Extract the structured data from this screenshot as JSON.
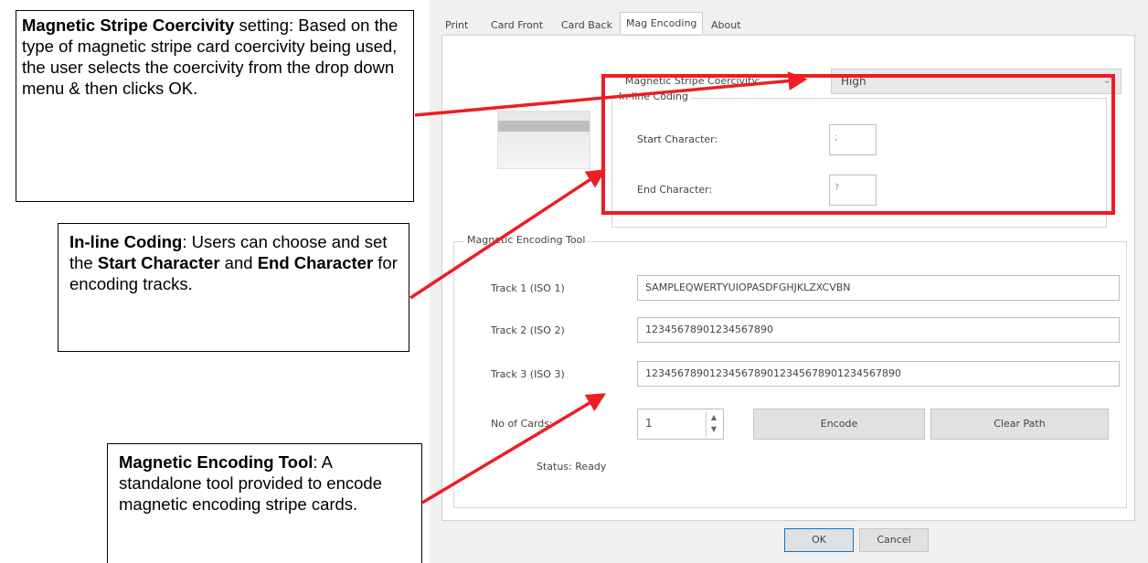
{
  "callouts": {
    "coercivity": {
      "title": "Magnetic Stripe Coercivity",
      "text": " setting: Based on the type of magnetic stripe card coercivity being used, the user selects the coercivity from the drop down menu & then clicks OK."
    },
    "inline": {
      "title": "In-line Coding",
      "text1": ": Users can choose and set the ",
      "bold1": "Start Character",
      "text2": " and ",
      "bold2": "End Character",
      "text3": " for encoding tracks."
    },
    "encoding": {
      "title": "Magnetic Encoding Tool",
      "text": ": A standalone tool provided to encode magnetic encoding stripe cards."
    }
  },
  "tabs": [
    "Print",
    "Card Front",
    "Card Back",
    "Mag Encoding",
    "About"
  ],
  "active_tab": "Mag Encoding",
  "coercivity": {
    "label": "Magnetic Stripe Coercivity:",
    "value": "High"
  },
  "inline": {
    "title": "In-line Coding",
    "start_label": "Start Character:",
    "start_value": ";",
    "end_label": "End Character:",
    "end_value": "?"
  },
  "encoding": {
    "title": "Magnetic Encoding Tool",
    "track1_label": "Track 1 (ISO 1)",
    "track1_value": "SAMPLEQWERTYUIOPASDFGHJKLZXCVBN",
    "track2_label": "Track 2 (ISO 2)",
    "track2_value": "12345678901234567890",
    "track3_label": "Track 3 (ISO 3)",
    "track3_value": "1234567890123456789012345678901234567890",
    "cards_label": "No of Cards:",
    "cards_value": "1",
    "encode_label": "Encode",
    "clear_label": "Clear Path",
    "status": "Status: Ready"
  },
  "buttons": {
    "ok": "OK",
    "cancel": "Cancel"
  },
  "colors": {
    "annotation": "#ee1c24"
  }
}
